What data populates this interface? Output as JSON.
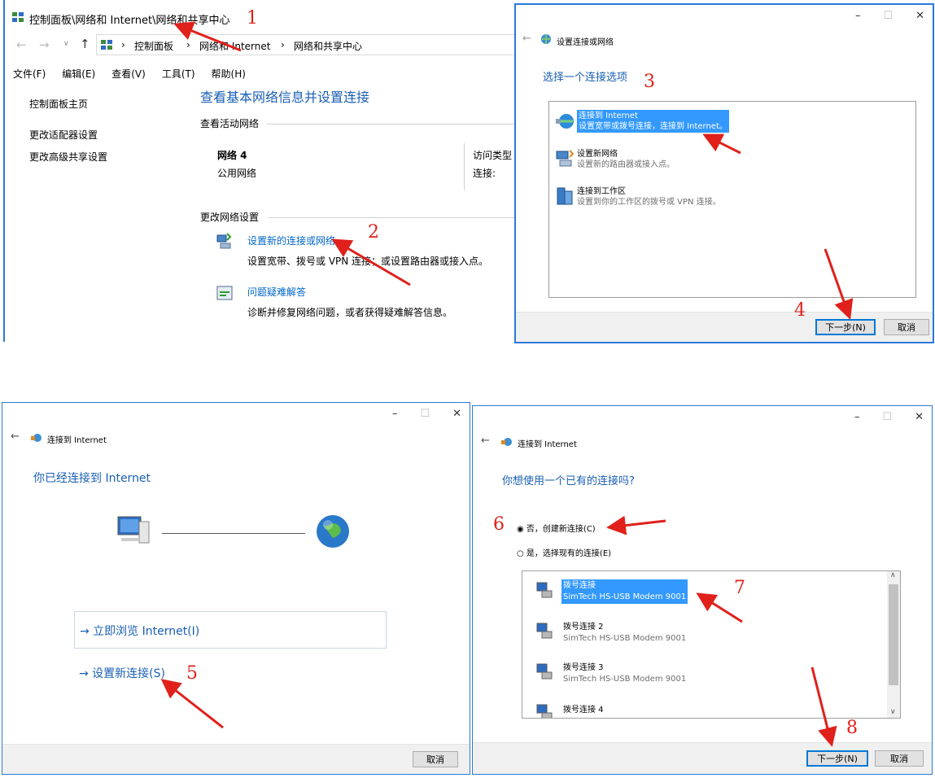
{
  "panel1": {
    "title": "控制面板\\网络和 Internet\\网络和共享中心",
    "breadcrumb": [
      "控制面板",
      "网络和 Internet",
      "网络和共享中心"
    ],
    "menu": [
      "文件(F)",
      "编辑(E)",
      "查看(V)",
      "工具(T)",
      "帮助(H)"
    ],
    "sidebar": [
      "控制面板主页",
      "更改适配器设置",
      "更改高级共享设置"
    ],
    "heading": "查看基本网络信息并设置连接",
    "active_networks_label": "查看活动网络",
    "network_name": "网络 4",
    "network_type": "公用网络",
    "access_type_label": "访问类型",
    "connections_label": "连接:",
    "change_settings_label": "更改网络设置",
    "setup_link": "设置新的连接或网络",
    "setup_desc": "设置宽带、拨号或 VPN 连接；或设置路由器或接入点。",
    "troubleshoot_link": "问题疑难解答",
    "troubleshoot_desc": "诊断并修复网络问题，或者获得疑难解答信息。"
  },
  "panel2": {
    "title": "设置连接或网络",
    "heading": "选择一个连接选项",
    "options": [
      {
        "title": "连接到 Internet",
        "desc": "设置宽带或拨号连接，连接到 Internet。"
      },
      {
        "title": "设置新网络",
        "desc": "设置新的路由器或接入点。"
      },
      {
        "title": "连接到工作区",
        "desc": "设置到你的工作区的拨号或 VPN 连接。"
      }
    ],
    "next": "下一步(N)",
    "cancel": "取消"
  },
  "panel3": {
    "title": "连接到 Internet",
    "heading": "你已经连接到 Internet",
    "browse": "→ 立即浏览 Internet(I)",
    "setup_new": "→ 设置新连接(S)",
    "cancel": "取消"
  },
  "panel4": {
    "title": "连接到 Internet",
    "heading": "你想使用一个已有的连接吗?",
    "radio_no": "否，创建新连接(C)",
    "radio_yes": "是，选择现有的连接(E)",
    "connections": [
      {
        "name": "拨号连接",
        "device": "SimTech HS-USB Modem 9001"
      },
      {
        "name": "拨号连接 2",
        "device": "SimTech HS-USB Modem 9001"
      },
      {
        "name": "拨号连接 3",
        "device": "SimTech HS-USB Modem 9001"
      },
      {
        "name": "拨号连接 4",
        "device": ""
      }
    ],
    "next": "下一步(N)",
    "cancel": "取消"
  },
  "annotations": [
    "1",
    "2",
    "3",
    "4",
    "5",
    "6",
    "7",
    "8"
  ],
  "colors": {
    "accent": "#1a5fb4",
    "selection": "#3399ff",
    "annotation": "#e0201a",
    "window_border": "#2b79d8"
  }
}
